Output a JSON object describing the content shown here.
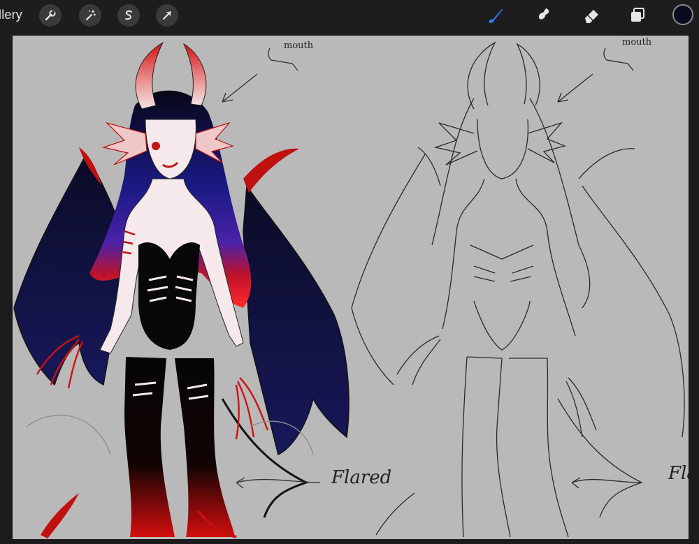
{
  "toolbar": {
    "gallery_label": "llery",
    "left_tools": [
      {
        "name": "actions",
        "icon": "wrench-icon"
      },
      {
        "name": "adjustments",
        "icon": "magic-wand-icon"
      },
      {
        "name": "selection",
        "icon": "selection-s-icon"
      },
      {
        "name": "transform",
        "icon": "arrow-cursor-icon"
      }
    ],
    "right_tools": [
      {
        "name": "brush",
        "icon": "brush-icon",
        "active": true
      },
      {
        "name": "smudge",
        "icon": "smudge-icon"
      },
      {
        "name": "eraser",
        "icon": "eraser-icon"
      },
      {
        "name": "layers",
        "icon": "layers-icon"
      }
    ],
    "active_color": "#090a1e",
    "accent_color": "#2f7ff0"
  },
  "canvas": {
    "background": "#b9b9b9",
    "annotations": {
      "left_mouth": "mouth",
      "right_mouth": "mouth",
      "left_flared": "Flared",
      "right_flared": "Fla"
    }
  }
}
